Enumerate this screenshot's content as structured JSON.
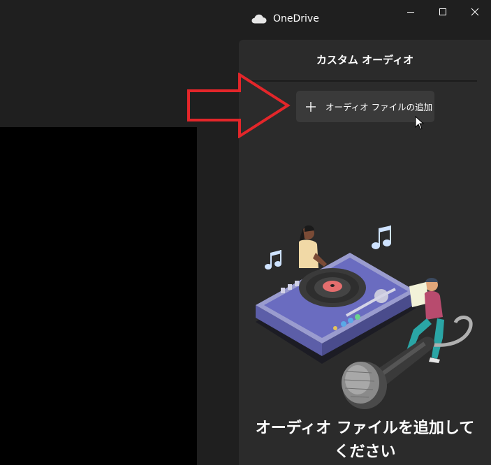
{
  "window": {
    "app_title": "OneDrive",
    "icon": "cloud-icon",
    "controls": [
      "minimize-icon",
      "maximize-icon",
      "close-icon"
    ]
  },
  "panel": {
    "title": "カスタム オーディオ",
    "add_button_label": "オーディオ ファイルの追加",
    "add_button_icon": "plus-icon",
    "empty_message": "オーディオ ファイルを追加してください"
  },
  "colors": {
    "background": "#1f1f1f",
    "panel": "#2b2b2b",
    "button": "#3a3a3a",
    "annotation_arrow": "#e3262a"
  }
}
